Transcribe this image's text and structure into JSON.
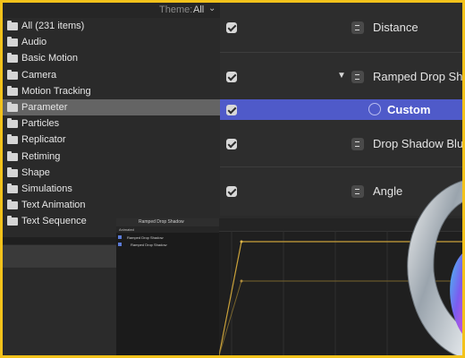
{
  "theme": {
    "label": "Theme:",
    "value": "All"
  },
  "categories": [
    {
      "label": "All (231 items)"
    },
    {
      "label": "Audio"
    },
    {
      "label": "Basic Motion"
    },
    {
      "label": "Camera"
    },
    {
      "label": "Motion Tracking"
    },
    {
      "label": "Parameter",
      "selected": true
    },
    {
      "label": "Particles"
    },
    {
      "label": "Replicator"
    },
    {
      "label": "Retiming"
    },
    {
      "label": "Shape"
    },
    {
      "label": "Simulations"
    },
    {
      "label": "Text Animation"
    },
    {
      "label": "Text Sequence"
    }
  ],
  "inspector": {
    "rows": [
      {
        "label": "Distance"
      },
      {
        "label": "Ramped Drop Shadow"
      },
      {
        "label": "Custom",
        "selected": true
      },
      {
        "label": "Drop Shadow Blur"
      },
      {
        "label": "Angle"
      }
    ]
  },
  "mini_panel": {
    "title": "Ramped Drop Shadow",
    "subtitle": "Animated",
    "rows": [
      {
        "label": "Ramped Drop Shadow"
      },
      {
        "label": "Ramped Drop Shadow"
      }
    ]
  },
  "colors": {
    "accent": "#4f5ac9",
    "frame": "#f3c21b",
    "curve": "#c9a13a"
  }
}
